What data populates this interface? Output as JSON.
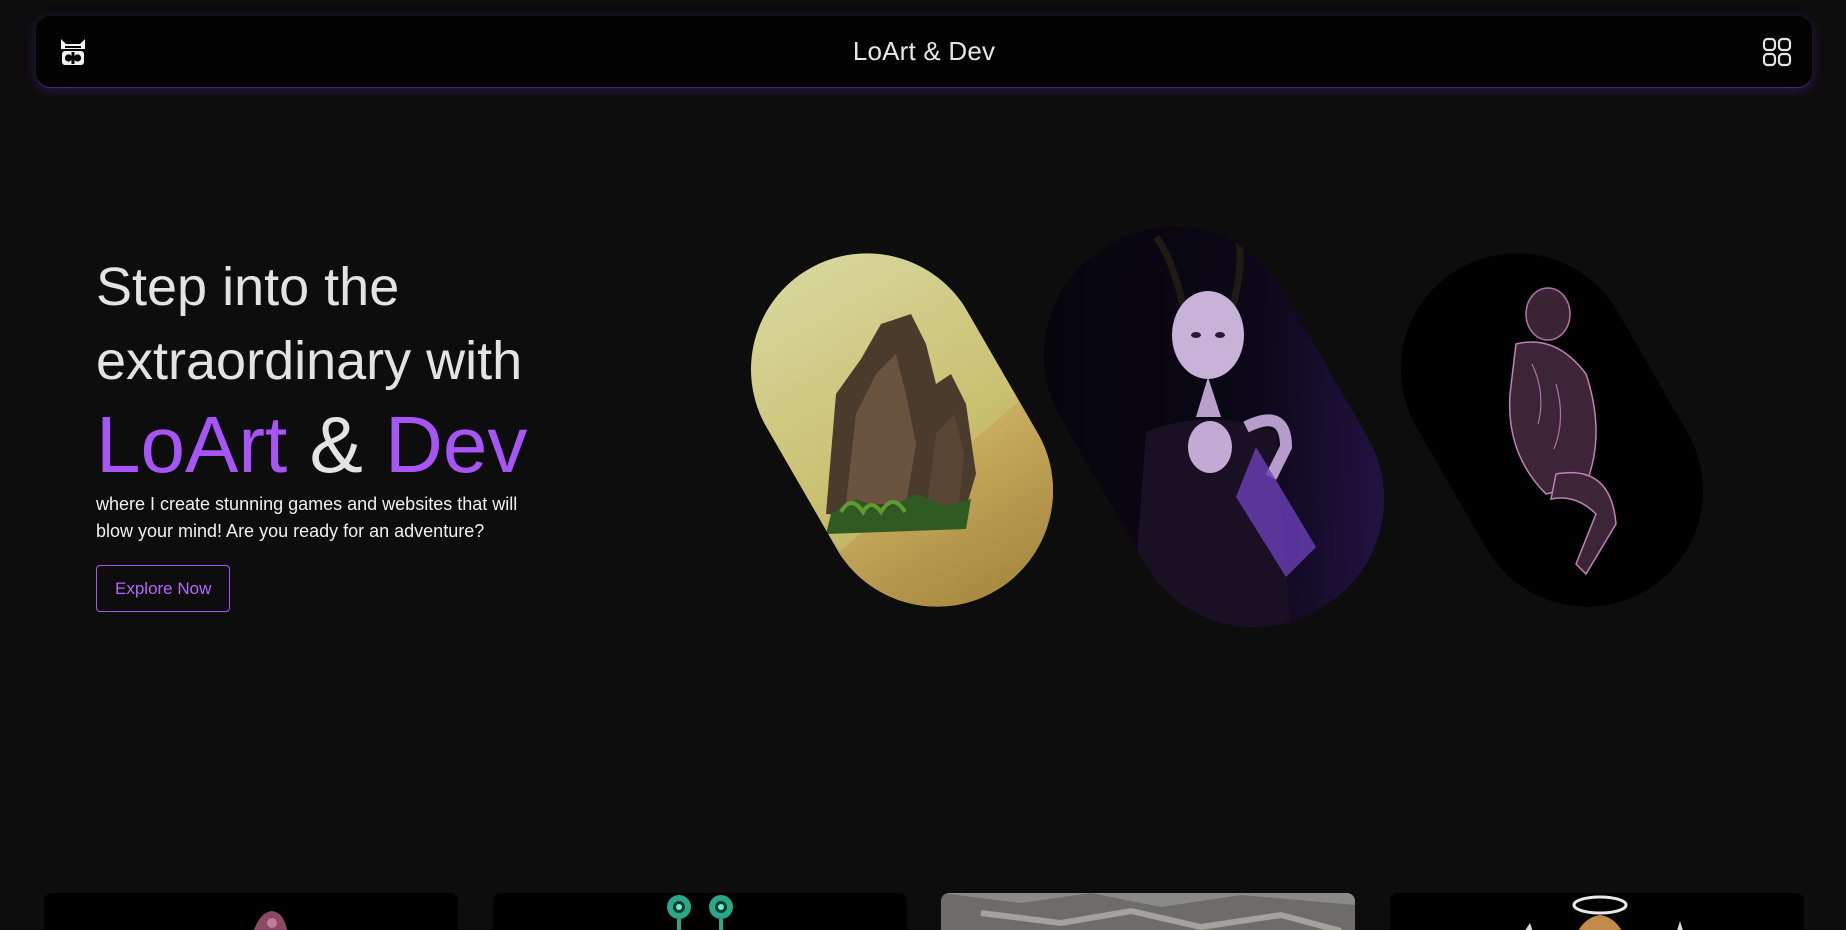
{
  "navbar": {
    "logo_icon": "mask-logo-icon",
    "title": "LoArt & Dev",
    "menu_icon": "grid-menu-icon"
  },
  "hero": {
    "line1": "Step into the",
    "line2": "extraordinary with",
    "brand_part1": "LoArt",
    "brand_amp": "&",
    "brand_part2": "Dev",
    "description": "where I create stunning games and websites that will blow your mind! Are you ready for an adventure?",
    "cta_label": "Explore Now"
  },
  "colors": {
    "background": "#0d0d0d",
    "navbar": "#020202",
    "accent": "#a855f7",
    "text": "#e3e3e3"
  },
  "gallery": {
    "pills": [
      "rock-landscape-render",
      "horned-demon-character",
      "crouching-figure-wireframe"
    ],
    "cards": [
      "pink-creature-thumbnail",
      "green-eyed-robot-thumbnail",
      "stone-texture-thumbnail",
      "angel-halo-thumbnail"
    ]
  }
}
